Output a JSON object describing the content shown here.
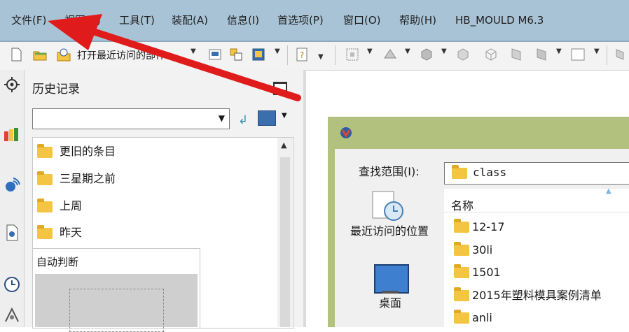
{
  "menubar": {
    "items": [
      {
        "label": "文件(F)"
      },
      {
        "label": "视图(V)"
      },
      {
        "label": "工具(T)"
      },
      {
        "label": "装配(A)"
      },
      {
        "label": "信息(I)"
      },
      {
        "label": "首选项(P)"
      },
      {
        "label": "窗口(O)"
      },
      {
        "label": "帮助(H)"
      },
      {
        "label": "HB_MOULD M6.3"
      }
    ]
  },
  "toolbar": {
    "open_recent_label": "打开最近访问的部件",
    "icons": [
      "new-icon",
      "open-icon",
      "open-recent-icon",
      "save-icon",
      "cut-icon",
      "paste-icon",
      "help-icon",
      "fit-icon",
      "orient-icon",
      "shaded-icon",
      "wireframe-icon",
      "render-icon",
      "view-icon",
      "box-icon",
      "layer-icon"
    ]
  },
  "history": {
    "title": "历史记录",
    "combo_value": "",
    "items": [
      {
        "label": "更旧的条目"
      },
      {
        "label": "三星期之前"
      },
      {
        "label": "上周"
      },
      {
        "label": "昨天"
      }
    ],
    "auto_label": "自动判断"
  },
  "dialog": {
    "lookin_label": "查找范围(I):",
    "lookin_value": "class",
    "places": [
      {
        "label": "最近访问的位置"
      },
      {
        "label": "桌面"
      }
    ],
    "name_header": "名称",
    "files": [
      {
        "label": "12-17"
      },
      {
        "label": "30li"
      },
      {
        "label": "1501"
      },
      {
        "label": "2015年塑料模具案例清单"
      },
      {
        "label": "anli"
      }
    ]
  },
  "colors": {
    "menubar_bg": "#a9c3d6",
    "dialog_frame": "#b3c17e",
    "folder": "#f4c542",
    "arrow": "#e01b1b"
  }
}
